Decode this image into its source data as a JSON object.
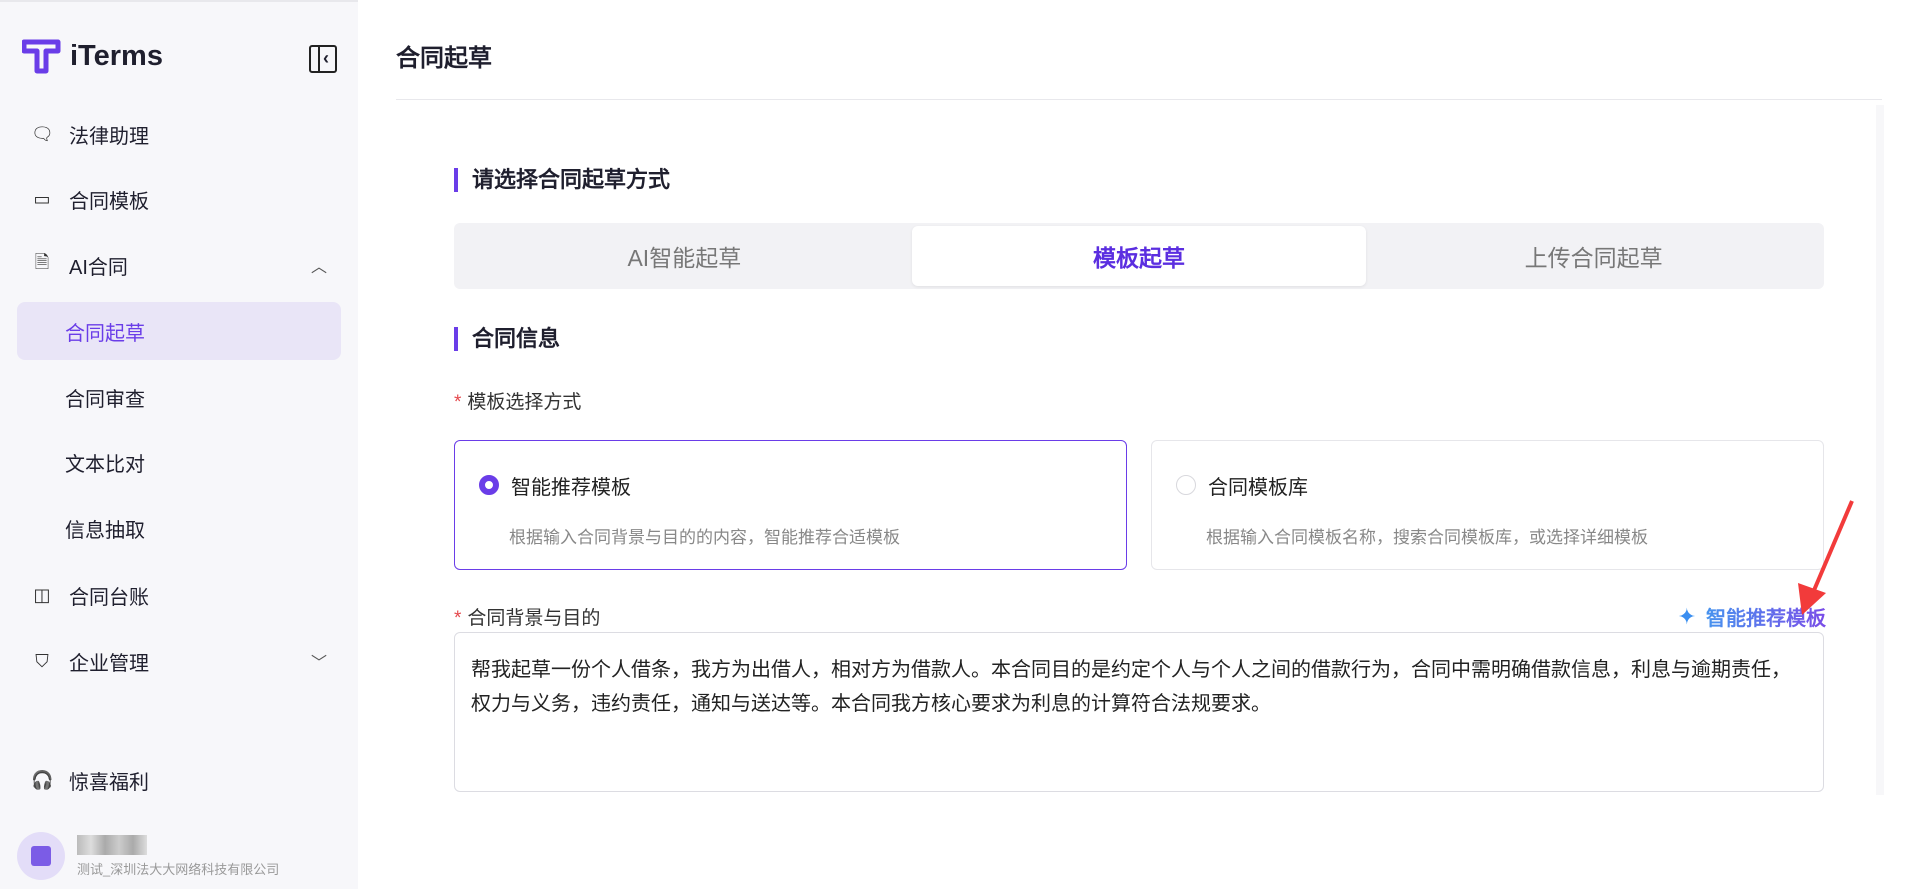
{
  "brand": {
    "name": "iTerms"
  },
  "sidebar": {
    "items": [
      {
        "label": "法律助理",
        "icon": "chat-icon"
      },
      {
        "label": "合同模板",
        "icon": "archive-icon"
      },
      {
        "label": "AI合同",
        "icon": "document-icon",
        "expanded": true
      },
      {
        "label": "合同起草",
        "active": true
      },
      {
        "label": "合同审查"
      },
      {
        "label": "文本比对"
      },
      {
        "label": "信息抽取"
      },
      {
        "label": "合同台账",
        "icon": "ledger-icon"
      },
      {
        "label": "企业管理",
        "icon": "shield-icon",
        "expanded": false
      }
    ],
    "bonus": "惊喜福利",
    "user": {
      "company": "测试_深圳法大大网络科技有限公司"
    }
  },
  "main": {
    "title": "合同起草",
    "section1": "请选择合同起草方式",
    "tabs": [
      {
        "label": "AI智能起草"
      },
      {
        "label": "模板起草",
        "active": true
      },
      {
        "label": "上传合同起草"
      }
    ],
    "section2": "合同信息",
    "template_mode_label": "模板选择方式",
    "cards": [
      {
        "title": "智能推荐模板",
        "desc": "根据输入合同背景与目的的内容，智能推荐合适模板",
        "selected": true
      },
      {
        "title": "合同模板库",
        "desc": "根据输入合同模板名称，搜索合同模板库，或选择详细模板",
        "selected": false
      }
    ],
    "background_label": "合同背景与目的",
    "smart_button": "智能推荐模板",
    "background_value": "帮我起草一份个人借条，我方为出借人，相对方为借款人。本合同目的是约定个人与个人之间的借款行为，合同中需明确借款信息，利息与逾期责任，权力与义务，违约责任，通知与送达等。本合同我方核心要求为利息的计算符合法规要求。",
    "accent": "#6a3de8"
  }
}
